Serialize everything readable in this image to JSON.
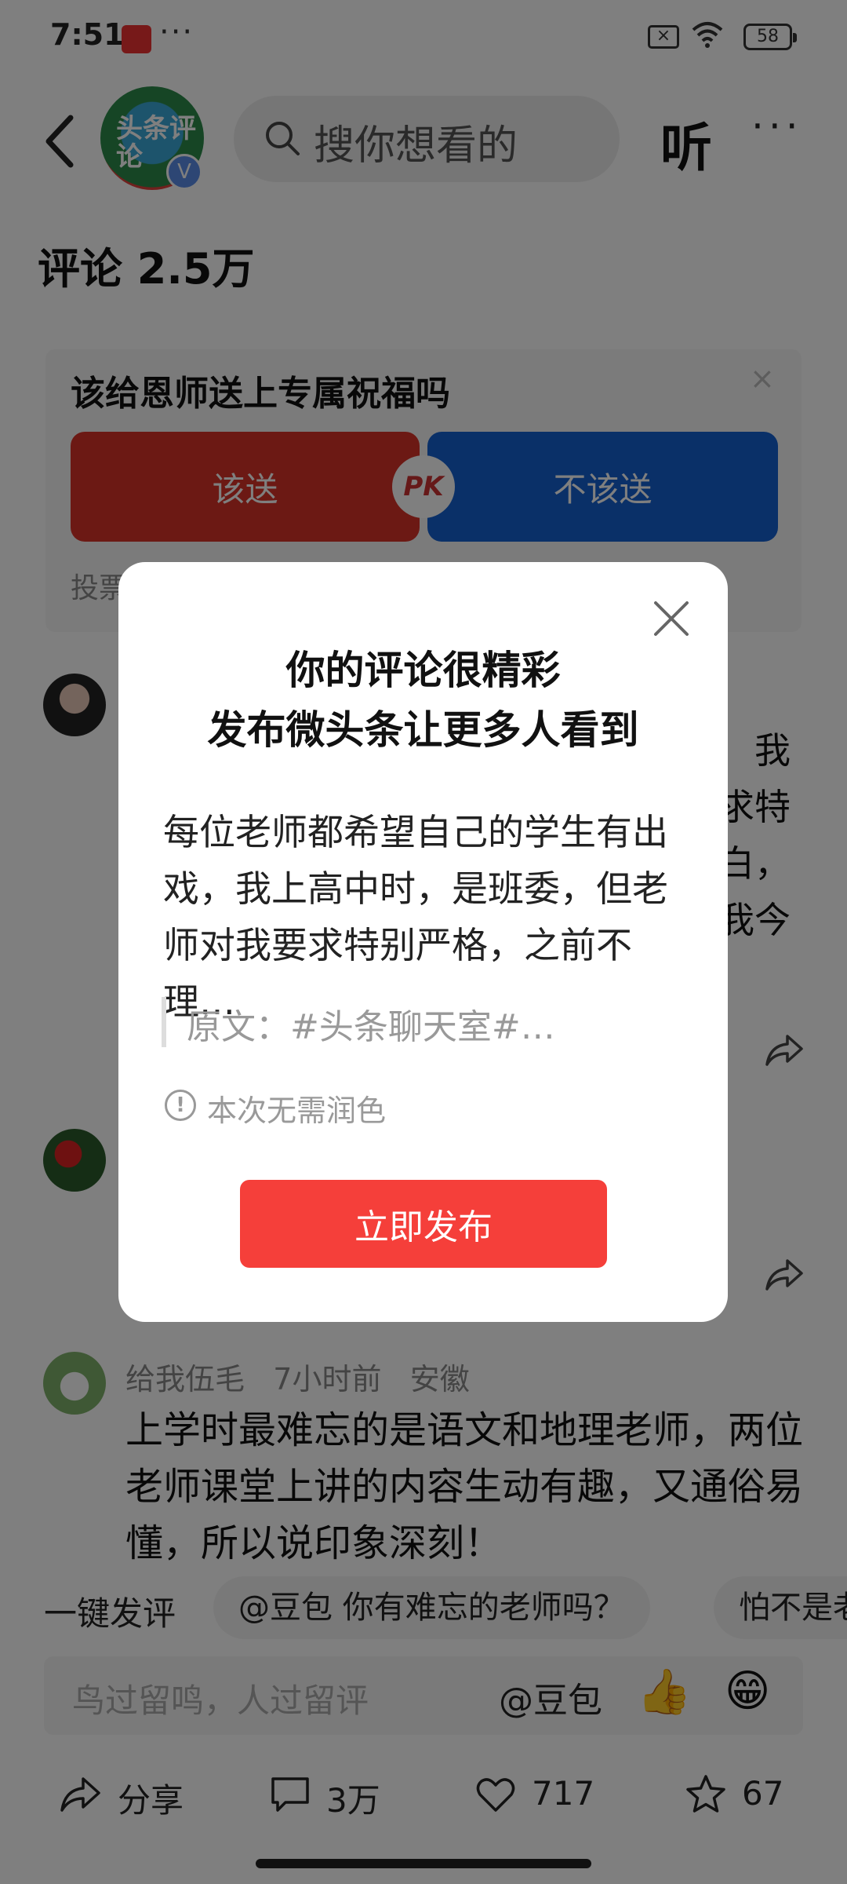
{
  "status_bar": {
    "time": "7:51",
    "dots": "···",
    "battery": "58"
  },
  "header": {
    "search_placeholder": "搜你想看的",
    "listen_label": "听",
    "more_label": "···",
    "logo_text": "头条评论",
    "verify_badge": "V"
  },
  "comments_header": {
    "title": "评论 2.5万"
  },
  "poll": {
    "question": "该给恩师送上专属祝福吗",
    "option_yes": "该送",
    "option_no": "不该送",
    "pk_label": "PK",
    "close_label": "×",
    "note": "投票"
  },
  "comments": {
    "c1_partial_lines": [
      "我",
      "求特",
      "白，",
      "我今"
    ],
    "c3": {
      "username": "给我伍毛",
      "time": "7小时前",
      "location": "安徽",
      "text": "上学时最难忘的是语文和地理老师，两位老师课堂上讲的内容生动有趣，又通俗易懂，所以说印象深刻！"
    }
  },
  "quick_reply": {
    "label": "一键发评",
    "chips": [
      "@豆包 你有难忘的老师吗？",
      "怕不是老"
    ]
  },
  "input_bar": {
    "placeholder": "鸟过留鸣，人过留评",
    "mention": "@豆包",
    "emoji_thumb": "👍",
    "emoji_grin": "😁"
  },
  "bottom_bar": {
    "share_label": "分享",
    "comment_count": "3万",
    "like_count": "717",
    "fav_count": "67"
  },
  "modal": {
    "title_line1": "你的评论很精彩",
    "title_line2": "发布微头条让更多人看到",
    "body": "每位老师都希望自己的学生有出戏，我上高中时，是班委，但老师对我要求特别严格，之前不理…",
    "quote": "原文：#头条聊天室#…",
    "info_icon": "!",
    "info_text": "本次无需润色",
    "publish_label": "立即发布"
  },
  "colors": {
    "poll_yes": "#d93228",
    "poll_no": "#1560d0",
    "publish": "#f53f3a",
    "overlay": "rgba(0,0,0,0.5)"
  }
}
